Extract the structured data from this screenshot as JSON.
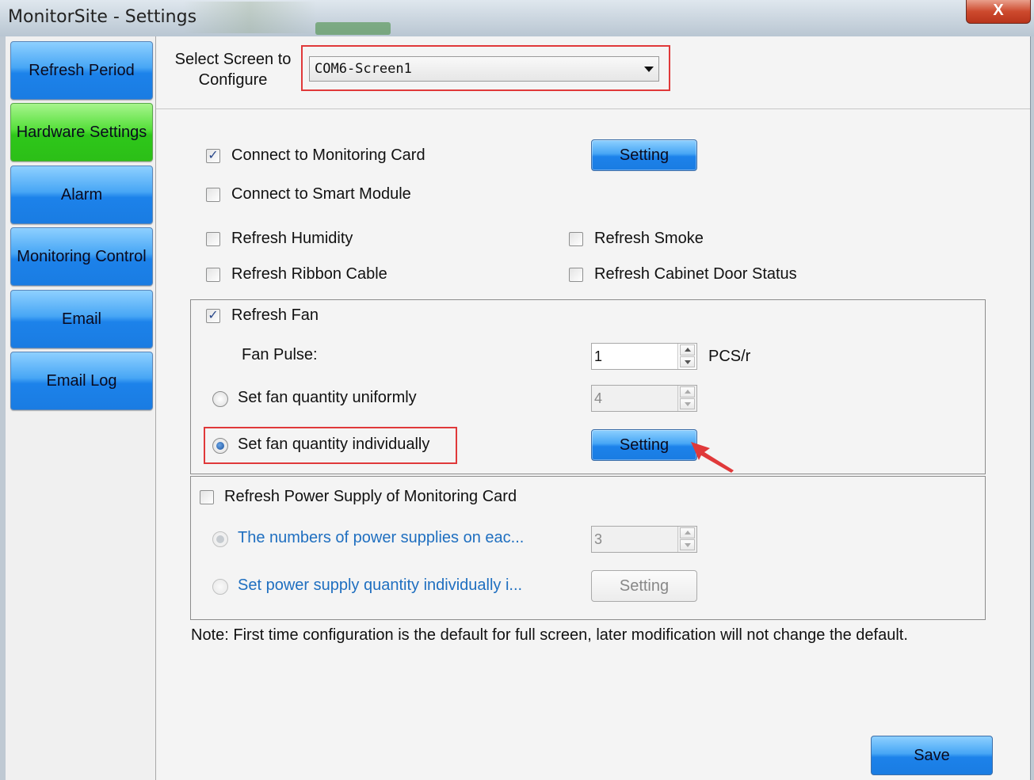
{
  "window": {
    "title": "MonitorSite - Settings",
    "close_label": "X"
  },
  "sidebar": {
    "items": [
      {
        "label": "Refresh Period"
      },
      {
        "label": "Hardware Settings"
      },
      {
        "label": "Alarm"
      },
      {
        "label": "Monitoring Control"
      },
      {
        "label": "Email"
      },
      {
        "label": "Email Log"
      }
    ],
    "active_index": 1
  },
  "screen_select": {
    "label": "Select Screen to Configure",
    "value": "COM6-Screen1"
  },
  "card": {
    "connect_monitoring_card": {
      "label": "Connect to Monitoring Card",
      "checked": true
    },
    "setting_label": "Setting",
    "connect_smart_module": {
      "label": "Connect to Smart Module",
      "checked": false
    },
    "refresh_humidity": {
      "label": "Refresh Humidity",
      "checked": false
    },
    "refresh_smoke": {
      "label": "Refresh Smoke",
      "checked": false
    },
    "refresh_ribbon_cable": {
      "label": "Refresh Ribbon Cable",
      "checked": false
    },
    "refresh_cabinet_door": {
      "label": "Refresh Cabinet Door Status",
      "checked": false
    }
  },
  "fan": {
    "refresh_fan": {
      "label": "Refresh Fan",
      "checked": true
    },
    "pulse_label": "Fan Pulse:",
    "pulse_value": "1",
    "pulse_unit": "PCS/r",
    "uniform_label": "Set fan quantity uniformly",
    "uniform_value": "4",
    "individual_label": "Set fan quantity individually",
    "setting_label": "Setting",
    "selected_mode": "individually"
  },
  "power": {
    "refresh_power": {
      "label": "Refresh Power Supply of Monitoring Card",
      "checked": false
    },
    "numbers_label": "The numbers of power supplies on eac...",
    "numbers_value": "3",
    "individual_label": "Set power supply quantity individually i...",
    "setting_label": "Setting"
  },
  "note": "Note: First time configuration is the default for full screen, later modification will not change the default.",
  "save_label": "Save",
  "colors": {
    "nav_blue": "#1c82ea",
    "nav_active_green": "#2ec71a",
    "highlight_red": "#e0393a",
    "disabled_blue_text": "#1f6fc0"
  }
}
